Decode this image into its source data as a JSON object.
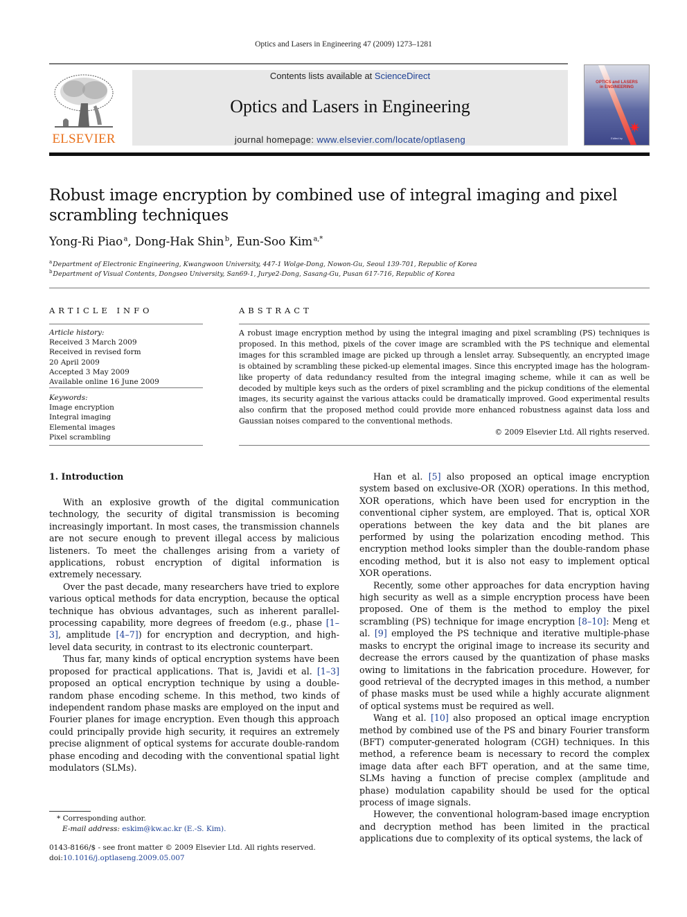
{
  "running_head": "Optics and Lasers in Engineering 47 (2009) 1273–1281",
  "publisher_logo": {
    "wordmark": "ELSEVIER",
    "icon": "elsevier-tree-icon",
    "color": "#e9711c"
  },
  "banner": {
    "contents_prefix": "Contents lists available at ",
    "contents_link": "ScienceDirect",
    "journal_name": "Optics and Lasers in Engineering",
    "homepage_prefix": "journal homepage: ",
    "homepage_link": "www.elsevier.com/locate/optlaseng",
    "link_color": "#1c3f94"
  },
  "cover": {
    "title_line1": "OPTICS and LASERS",
    "title_line2": "in ENGINEERING",
    "editor_line": "Edited by",
    "icon": "laser-star-icon"
  },
  "article": {
    "title": "Robust image encryption by combined use of integral imaging and pixel scrambling techniques",
    "authors": [
      {
        "name": "Yong-Ri Piao",
        "sup": "a"
      },
      {
        "name": "Dong-Hak Shin",
        "sup": "b"
      },
      {
        "name": "Eun-Soo Kim",
        "sup": "a,*"
      }
    ],
    "affiliations": [
      {
        "sup": "a",
        "text": "Department of Electronic Engineering, Kwangwoon University, 447-1 Wolge-Dong, Nowon-Gu, Seoul 139-701, Republic of Korea"
      },
      {
        "sup": "b",
        "text": "Department of Visual Contents, Dongseo University, San69-1, Jurye2-Dong, Sasang-Gu, Pusan 617-716, Republic of Korea"
      }
    ]
  },
  "article_info": {
    "heading": "ARTICLE INFO",
    "history_label": "Article history:",
    "history": [
      "Received 3 March 2009",
      "Received in revised form",
      "20 April 2009",
      "Accepted 3 May 2009",
      "Available online 16 June 2009"
    ],
    "keywords_label": "Keywords:",
    "keywords": [
      "Image encryption",
      "Integral imaging",
      "Elemental images",
      "Pixel scrambling"
    ]
  },
  "abstract": {
    "heading": "ABSTRACT",
    "text": "A robust image encryption method by using the integral imaging and pixel scrambling (PS) techniques is proposed. In this method, pixels of the cover image are scrambled with the PS technique and elemental images for this scrambled image are picked up through a lenslet array. Subsequently, an encrypted image is obtained by scrambling these picked-up elemental images. Since this encrypted image has the hologram-like property of data redundancy resulted from the integral imaging scheme, while it can as well be decoded by multiple keys such as the orders of pixel scrambling and the pickup conditions of the elemental images, its security against the various attacks could be dramatically improved. Good experimental results also confirm that the proposed method could provide more enhanced robustness against data loss and Gaussian noises compared to the conventional methods.",
    "copyright": "© 2009 Elsevier Ltd. All rights reserved."
  },
  "body": {
    "section_heading": "1.  Introduction",
    "left_paragraphs": [
      [
        {
          "t": "With an explosive growth of the digital communication technology, the security of digital transmission is becoming increasingly important. In most cases, the transmission channels are not secure enough to prevent illegal access by malicious listeners. To meet the challenges arising from a variety of applications, robust encryption of digital information is extremely necessary."
        }
      ],
      [
        {
          "t": "Over the past decade, many researchers have tried to explore various optical methods for data encryption, because the optical technique has obvious advantages, such as inherent parallel-processing capability, more degrees of freedom (e.g., phase "
        },
        {
          "r": "[1–3]"
        },
        {
          "t": ", amplitude "
        },
        {
          "r": "[4–7]"
        },
        {
          "t": ") for encryption and decryption, and high-level data security, in contrast to its electronic counterpart."
        }
      ],
      [
        {
          "t": "Thus far, many kinds of optical encryption systems have been proposed for practical applications. That is, Javidi et al. "
        },
        {
          "r": "[1–3]"
        },
        {
          "t": " proposed an optical encryption technique by using a double-random phase encoding scheme. In this method, two kinds of independent random phase masks are employed on the input and Fourier planes for image encryption. Even though this approach could principally provide high security, it requires an extremely precise alignment of optical systems for accurate double-random phase encoding and decoding with the conventional spatial light modulators (SLMs)."
        }
      ]
    ],
    "right_paragraphs": [
      [
        {
          "t": "Han et al. "
        },
        {
          "r": "[5]"
        },
        {
          "t": " also proposed an optical image encryption system based on exclusive-OR (XOR) operations. In this method, XOR operations, which have been used for encryption in the conventional cipher system, are employed. That is, optical XOR operations between the key data and the bit planes are performed by using the polarization encoding method. This encryption method looks simpler than the double-random phase encoding method, but it is also not easy to implement optical XOR operations."
        }
      ],
      [
        {
          "t": "Recently, some other approaches for data encryption having high security as well as a simple encryption process have been proposed. One of them is the method to employ the pixel scrambling (PS) technique for image encryption "
        },
        {
          "r": "[8–10]"
        },
        {
          "t": ": Meng et al. "
        },
        {
          "r": "[9]"
        },
        {
          "t": " employed the PS technique and iterative multiple-phase masks to encrypt the original image to increase its security and decrease the errors caused by the quantization of phase masks owing to limitations in the fabrication procedure. However, for good retrieval of the decrypted images in this method, a number of phase masks must be used while a highly accurate alignment of optical systems must be required as well."
        }
      ],
      [
        {
          "t": "Wang et al. "
        },
        {
          "r": "[10]"
        },
        {
          "t": " also proposed an optical image encryption method by combined use of the PS and binary Fourier transform (BFT) computer-generated hologram (CGH) techniques. In this method, a reference beam is necessary to record the complex image data after each BFT operation, and at the same time, SLMs having a function of precise complex (amplitude and phase) modulation capability should be used for the optical process of image signals."
        }
      ],
      [
        {
          "t": "However, the conventional hologram-based image encryption and decryption method has been limited in the practical applications due to complexity of its optical systems, the lack of"
        }
      ]
    ]
  },
  "footnotes": {
    "corresponding": "* Corresponding author.",
    "email_label": "E-mail address: ",
    "email": "eskim@kw.ac.kr",
    "email_suffix": " (E.-S. Kim).",
    "issn_line": "0143-8166/$ - see front matter © 2009 Elsevier Ltd. All rights reserved.",
    "doi_label": "doi:",
    "doi": "10.1016/j.optlaseng.2009.05.007"
  }
}
